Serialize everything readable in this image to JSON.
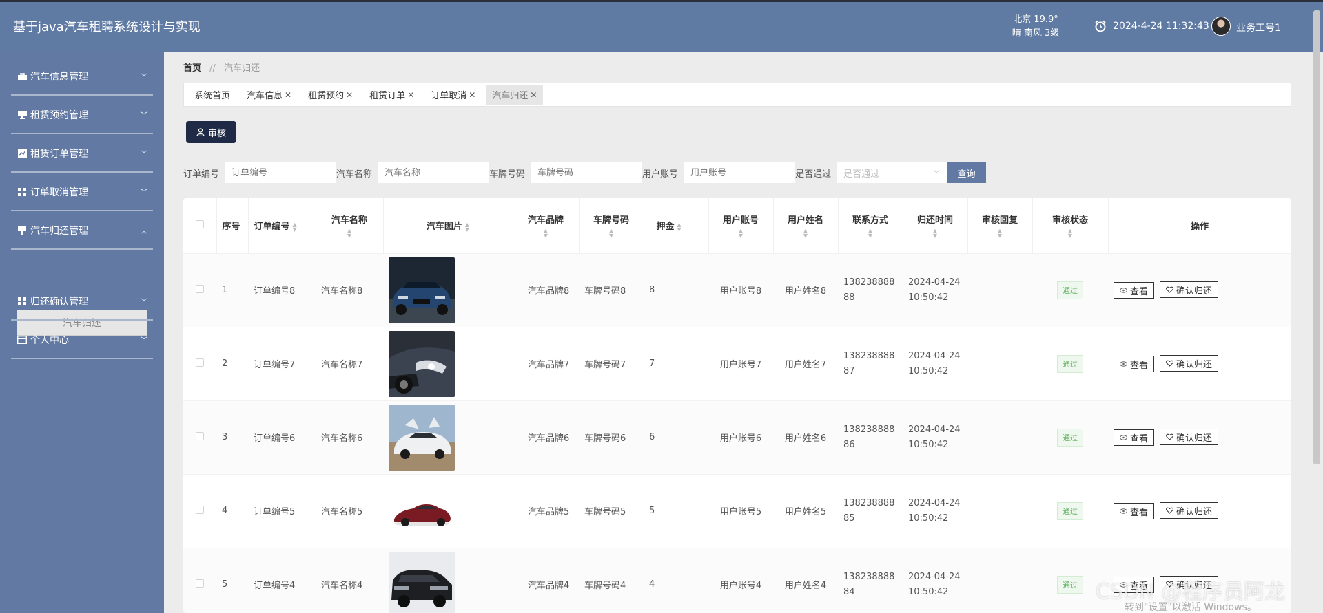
{
  "header": {
    "app_title": "基于java汽车租聘系统设计与实现",
    "weather_line1": "北京  19.9°",
    "weather_line2": "晴  南风  3级",
    "datetime": "2024-4-24 11:32:43",
    "user_name": "业务工号1"
  },
  "sidebar": {
    "items": [
      {
        "label": "汽车信息管理",
        "icon": "briefcase-icon",
        "expanded": false
      },
      {
        "label": "租赁预约管理",
        "icon": "monitor-icon",
        "expanded": false
      },
      {
        "label": "租赁订单管理",
        "icon": "chart-icon",
        "expanded": false
      },
      {
        "label": "订单取消管理",
        "icon": "grid-icon",
        "expanded": false
      },
      {
        "label": "汽车归还管理",
        "icon": "pin-icon",
        "expanded": true
      },
      {
        "label": "归还确认管理",
        "icon": "grid-icon",
        "expanded": false
      },
      {
        "label": "个人中心",
        "icon": "card-icon",
        "expanded": false
      }
    ],
    "active_submenu": "汽车归还"
  },
  "breadcrumb": {
    "home": "首页",
    "separator": "//",
    "current": "汽车归还"
  },
  "tabs": [
    {
      "label": "系统首页",
      "closable": false
    },
    {
      "label": "汽车信息",
      "closable": true
    },
    {
      "label": "租赁预约",
      "closable": true
    },
    {
      "label": "租赁订单",
      "closable": true
    },
    {
      "label": "订单取消",
      "closable": true
    },
    {
      "label": "汽车归还",
      "closable": true,
      "active": true
    }
  ],
  "toolbar": {
    "audit_label": "审核"
  },
  "filters": {
    "order_no_label": "订单编号",
    "order_no_placeholder": "订单编号",
    "car_name_label": "汽车名称",
    "car_name_placeholder": "汽车名称",
    "plate_label": "车牌号码",
    "plate_placeholder": "车牌号码",
    "account_label": "用户账号",
    "account_placeholder": "用户账号",
    "passed_label": "是否通过",
    "passed_placeholder": "是否通过",
    "query_label": "查询"
  },
  "table": {
    "headers": {
      "index": "序号",
      "order_no": "订单编号",
      "car_name": "汽车名称",
      "car_image": "汽车图片",
      "brand": "汽车品牌",
      "plate": "车牌号码",
      "deposit": "押金",
      "account": "用户账号",
      "user_name": "用户姓名",
      "contact": "联系方式",
      "return_time": "归还时间",
      "reply": "审核回复",
      "status": "审核状态",
      "ops": "操作"
    },
    "view_label": "查看",
    "confirm_label": "确认归还",
    "rows": [
      {
        "index": "1",
        "order_no": "订单编号8",
        "car_name": "汽车名称8",
        "image": "car-photo-blue-sedan",
        "brand": "汽车品牌8",
        "plate": "车牌号码8",
        "deposit": "8",
        "account": "用户账号8",
        "user_name": "用户姓名8",
        "phone1": "138238888",
        "phone2": "88",
        "date": "2024-04-24",
        "time": "10:50:42",
        "reply": "",
        "status": "通过"
      },
      {
        "index": "2",
        "order_no": "订单编号7",
        "car_name": "汽车名称7",
        "image": "car-photo-dark-headlight",
        "brand": "汽车品牌7",
        "plate": "车牌号码7",
        "deposit": "7",
        "account": "用户账号7",
        "user_name": "用户姓名7",
        "phone1": "138238888",
        "phone2": "87",
        "date": "2024-04-24",
        "time": "10:50:42",
        "reply": "",
        "status": "通过"
      },
      {
        "index": "3",
        "order_no": "订单编号6",
        "car_name": "汽车名称6",
        "image": "car-photo-white-gullwing",
        "brand": "汽车品牌6",
        "plate": "车牌号码6",
        "deposit": "6",
        "account": "用户账号6",
        "user_name": "用户姓名6",
        "phone1": "138238888",
        "phone2": "86",
        "date": "2024-04-24",
        "time": "10:50:42",
        "reply": "",
        "status": "通过"
      },
      {
        "index": "4",
        "order_no": "订单编号5",
        "car_name": "汽车名称5",
        "image": "car-photo-red-sedan",
        "brand": "汽车品牌5",
        "plate": "车牌号码5",
        "deposit": "5",
        "account": "用户账号5",
        "user_name": "用户姓名5",
        "phone1": "138238888",
        "phone2": "85",
        "date": "2024-04-24",
        "time": "10:50:42",
        "reply": "",
        "status": "通过"
      },
      {
        "index": "5",
        "order_no": "订单编号4",
        "car_name": "汽车名称4",
        "image": "car-photo-black-suv",
        "brand": "汽车品牌4",
        "plate": "车牌号码4",
        "deposit": "4",
        "account": "用户账号4",
        "user_name": "用户姓名4",
        "phone1": "138238888",
        "phone2": "84",
        "date": "2024-04-24",
        "time": "10:50:42",
        "reply": "",
        "status": "通过"
      }
    ]
  },
  "overlay": {
    "watermark": "CSDN @程序员阿龙",
    "activate_windows": "转到\"设置\"以激活 Windows。"
  },
  "colors": {
    "header_bg": "#5f7aa3",
    "sidebar_bg": "#6279a3",
    "audit_btn": "#1f2b46",
    "badge_green": "#6ab56a"
  }
}
